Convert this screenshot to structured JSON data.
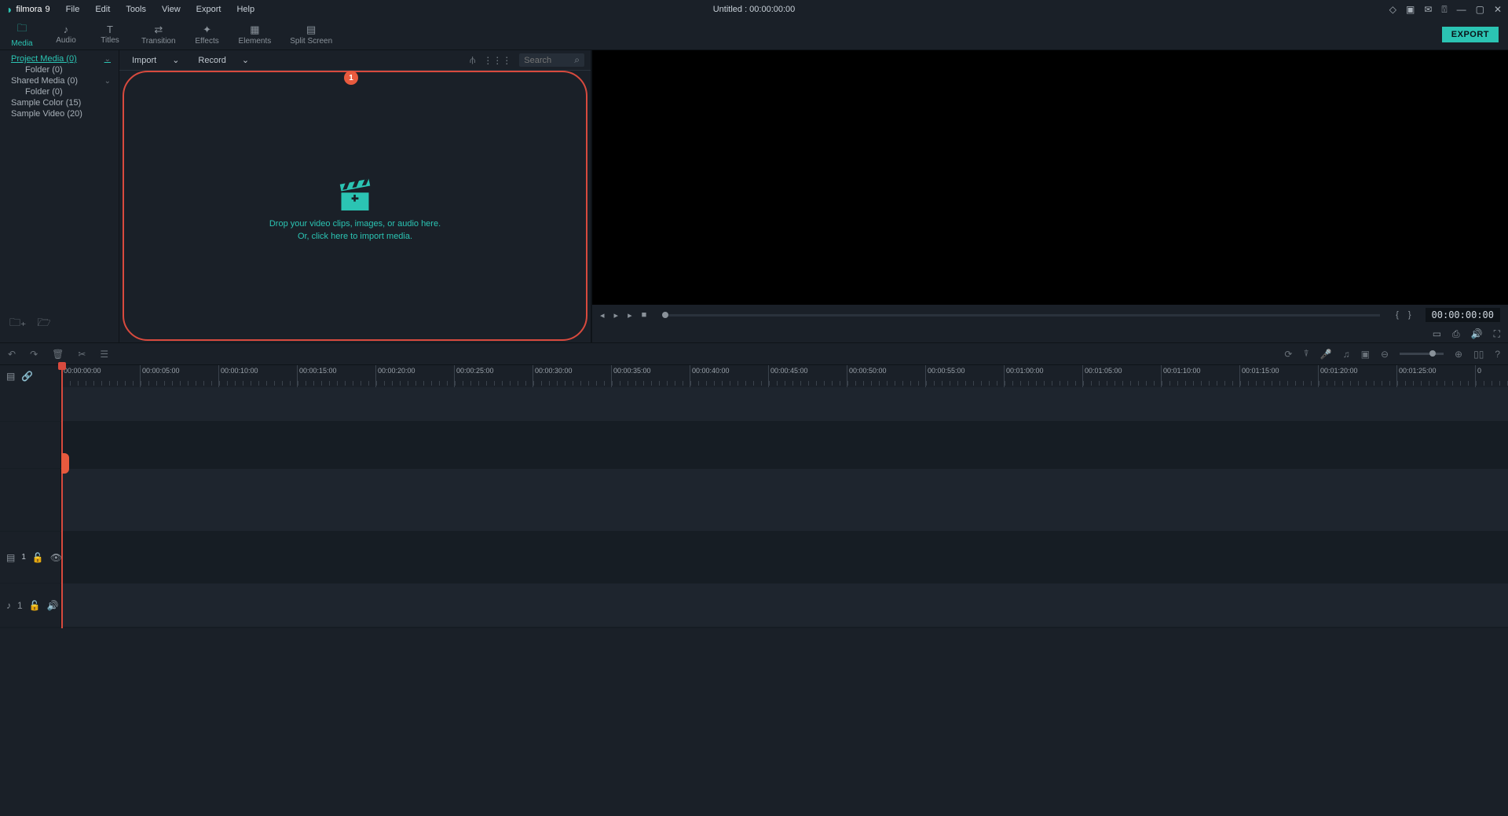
{
  "app": {
    "name": "filmora",
    "version": "9"
  },
  "menus": [
    "File",
    "Edit",
    "Tools",
    "View",
    "Export",
    "Help"
  ],
  "title": "Untitled : 00:00:00:00",
  "toptabs": [
    {
      "label": "Media",
      "icon": "folder",
      "active": true
    },
    {
      "label": "Audio",
      "icon": "music",
      "active": false
    },
    {
      "label": "Titles",
      "icon": "text",
      "active": false
    },
    {
      "label": "Transition",
      "icon": "transition",
      "active": false
    },
    {
      "label": "Effects",
      "icon": "sparkle",
      "active": false
    },
    {
      "label": "Elements",
      "icon": "image",
      "active": false
    },
    {
      "label": "Split Screen",
      "icon": "grid",
      "active": false
    }
  ],
  "export_label": "EXPORT",
  "library": {
    "items": [
      {
        "label": "Project Media (0)",
        "selected": true,
        "hasChevron": true,
        "child": false
      },
      {
        "label": "Folder (0)",
        "selected": false,
        "hasChevron": false,
        "child": true
      },
      {
        "label": "Shared Media (0)",
        "selected": false,
        "hasChevron": true,
        "child": false
      },
      {
        "label": "Folder (0)",
        "selected": false,
        "hasChevron": false,
        "child": true
      },
      {
        "label": "Sample Color (15)",
        "selected": false,
        "hasChevron": false,
        "child": false
      },
      {
        "label": "Sample Video (20)",
        "selected": false,
        "hasChevron": false,
        "child": false
      }
    ]
  },
  "media_bar": {
    "import_label": "Import",
    "record_label": "Record",
    "search_placeholder": "Search"
  },
  "annotation_badge": "1",
  "dropzone": {
    "line1": "Drop your video clips, images, or audio here.",
    "line2": "Or, click here to import media."
  },
  "preview": {
    "timecode": "00:00:00:00"
  },
  "ruler_labels": [
    "00:00:00:00",
    "00:00:05:00",
    "00:00:10:00",
    "00:00:15:00",
    "00:00:20:00",
    "00:00:25:00",
    "00:00:30:00",
    "00:00:35:00",
    "00:00:40:00",
    "00:00:45:00",
    "00:00:50:00",
    "00:00:55:00",
    "00:01:00:00",
    "00:01:05:00",
    "00:01:10:00",
    "00:01:15:00",
    "00:01:20:00",
    "00:01:25:00",
    "0"
  ],
  "tracks": {
    "video_index": "1",
    "audio_index": "1"
  }
}
